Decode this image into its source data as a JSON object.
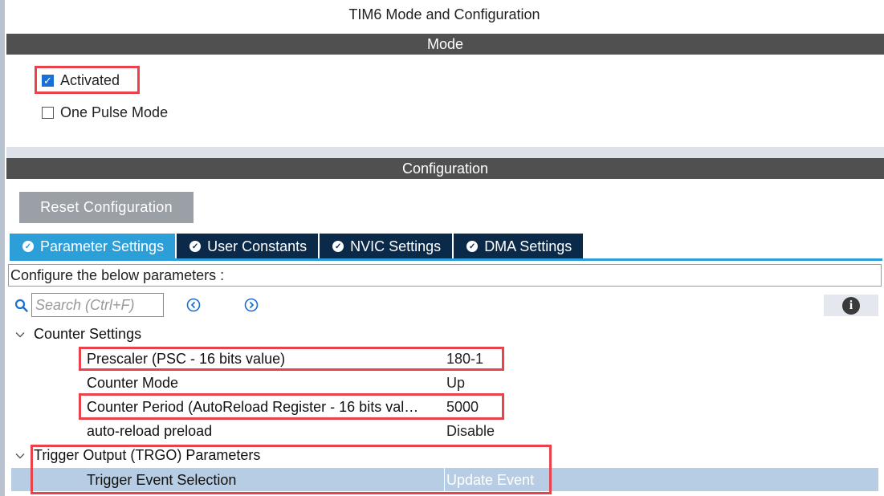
{
  "title": "TIM6 Mode and Configuration",
  "mode": {
    "header": "Mode",
    "activated": {
      "label": "Activated",
      "checked": true
    },
    "one_pulse": {
      "label": "One Pulse Mode",
      "checked": false
    }
  },
  "configuration": {
    "header": "Configuration",
    "reset_label": "Reset Configuration",
    "tabs": [
      {
        "label": "Parameter Settings",
        "active": true,
        "icon": "check-circle-icon"
      },
      {
        "label": "User Constants",
        "active": false,
        "icon": "check-circle-icon"
      },
      {
        "label": "NVIC Settings",
        "active": false,
        "icon": "check-circle-icon"
      },
      {
        "label": "DMA Settings",
        "active": false,
        "icon": "check-circle-icon"
      }
    ],
    "description": "Configure the below parameters :",
    "search_placeholder": "Search (Ctrl+F)",
    "groups": [
      {
        "name": "Counter Settings",
        "params": [
          {
            "name": "Prescaler (PSC - 16 bits value)",
            "value": "180-1"
          },
          {
            "name": "Counter Mode",
            "value": "Up"
          },
          {
            "name": "Counter Period (AutoReload Register - 16 bits val…",
            "value": "5000"
          },
          {
            "name": "auto-reload preload",
            "value": "Disable"
          }
        ]
      },
      {
        "name": "Trigger Output (TRGO) Parameters",
        "params": [
          {
            "name": "Trigger Event Selection",
            "value": "Update Event"
          }
        ]
      }
    ]
  },
  "colors": {
    "header_bar": "#505050",
    "tab_active": "#2c9fd9",
    "tab_inactive": "#0b2a4a",
    "highlight": "#e8434a",
    "selected_row": "#b7cde3"
  }
}
